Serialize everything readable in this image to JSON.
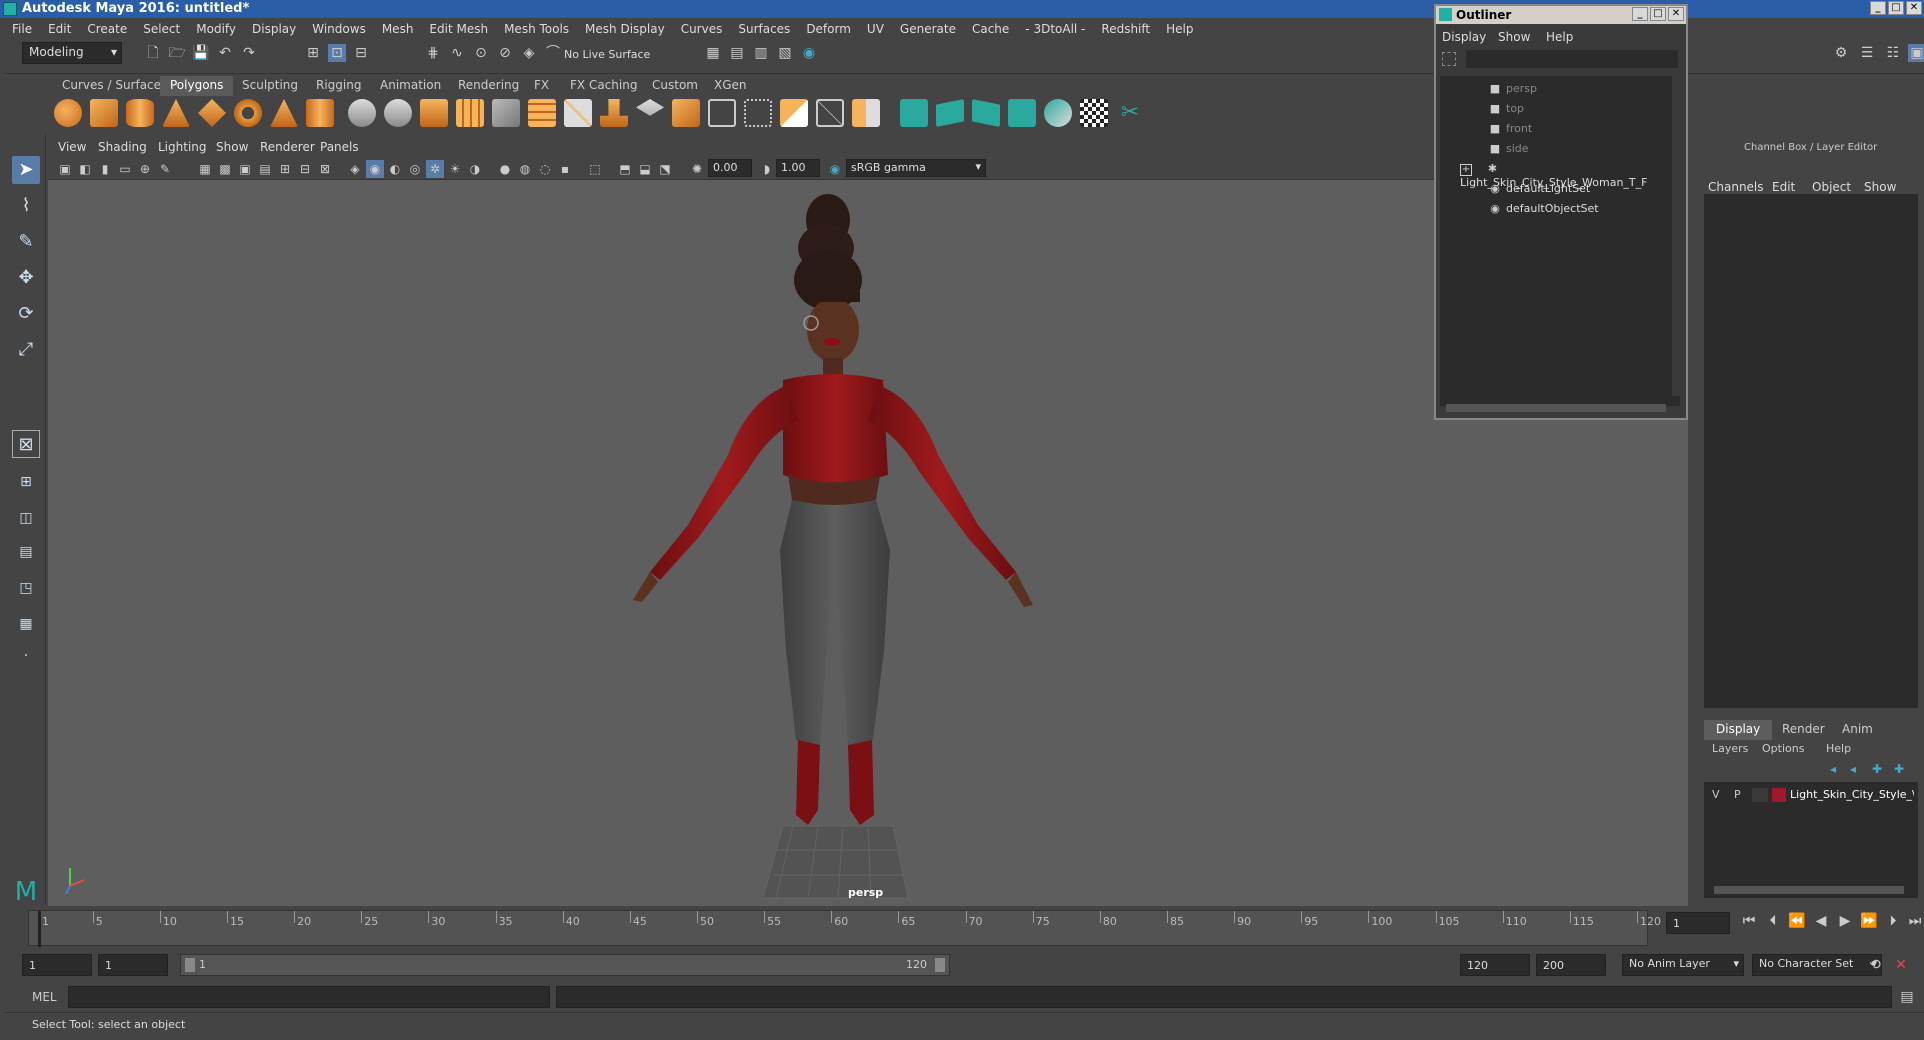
{
  "window": {
    "title": "Autodesk Maya 2016: untitled*"
  },
  "menubar": [
    "File",
    "Edit",
    "Create",
    "Select",
    "Modify",
    "Display",
    "Windows",
    "Mesh",
    "Edit Mesh",
    "Mesh Tools",
    "Mesh Display",
    "Curves",
    "Surfaces",
    "Deform",
    "UV",
    "Generate",
    "Cache",
    "- 3DtoAll -",
    "Redshift",
    "Help"
  ],
  "statusline": {
    "mode": "Modeling",
    "live_surface": "No Live Surface"
  },
  "shelf": {
    "tabs": [
      "Curves / Surfaces",
      "Polygons",
      "Sculpting",
      "Rigging",
      "Animation",
      "Rendering",
      "FX",
      "FX Caching",
      "Custom",
      "XGen"
    ],
    "active_tab": "Polygons"
  },
  "viewport": {
    "menu": [
      "View",
      "Shading",
      "Lighting",
      "Show",
      "Renderer",
      "Panels"
    ],
    "exposure": "0.00",
    "gamma": "1.00",
    "color_space": "sRGB gamma",
    "camera_label": "persp"
  },
  "outliner": {
    "title": "Outliner",
    "menu": [
      "Display",
      "Show",
      "Help"
    ],
    "items": [
      {
        "label": "persp",
        "icon": "camera-icon",
        "dim": true
      },
      {
        "label": "top",
        "icon": "camera-icon",
        "dim": true
      },
      {
        "label": "front",
        "icon": "camera-icon",
        "dim": true
      },
      {
        "label": "side",
        "icon": "camera-icon",
        "dim": true
      },
      {
        "label": "Light_Skin_City_Style_Woman_T_F",
        "icon": "mesh-group-icon",
        "dim": false
      },
      {
        "label": "defaultLightSet",
        "icon": "set-icon",
        "dim": false
      },
      {
        "label": "defaultObjectSet",
        "icon": "set-icon",
        "dim": false
      }
    ]
  },
  "channelbox": {
    "title": "Channel Box / Layer Editor",
    "menu": [
      "Channels",
      "Edit",
      "Object",
      "Show"
    ],
    "layer_tabs": [
      "Display",
      "Render",
      "Anim"
    ],
    "layer_menu": [
      "Layers",
      "Options",
      "Help"
    ],
    "layer": {
      "v": "V",
      "p": "P",
      "name": "Light_Skin_City_Style_\\",
      "color": "#a0182d"
    }
  },
  "timeline": {
    "ticks": [
      "1",
      "5",
      "10",
      "15",
      "20",
      "25",
      "30",
      "35",
      "40",
      "45",
      "50",
      "55",
      "60",
      "65",
      "70",
      "75",
      "80",
      "85",
      "90",
      "95",
      "100",
      "105",
      "110",
      "115",
      "120"
    ],
    "current_frame": "1"
  },
  "range": {
    "start": "1",
    "playback_start": "1",
    "slider_start": "1",
    "slider_end": "120",
    "playback_end": "120",
    "end": "200",
    "anim_layer": "No Anim Layer",
    "character_set": "No Character Set"
  },
  "cmdline": {
    "label": "MEL"
  },
  "helpline": {
    "text": "Select Tool: select an object"
  }
}
